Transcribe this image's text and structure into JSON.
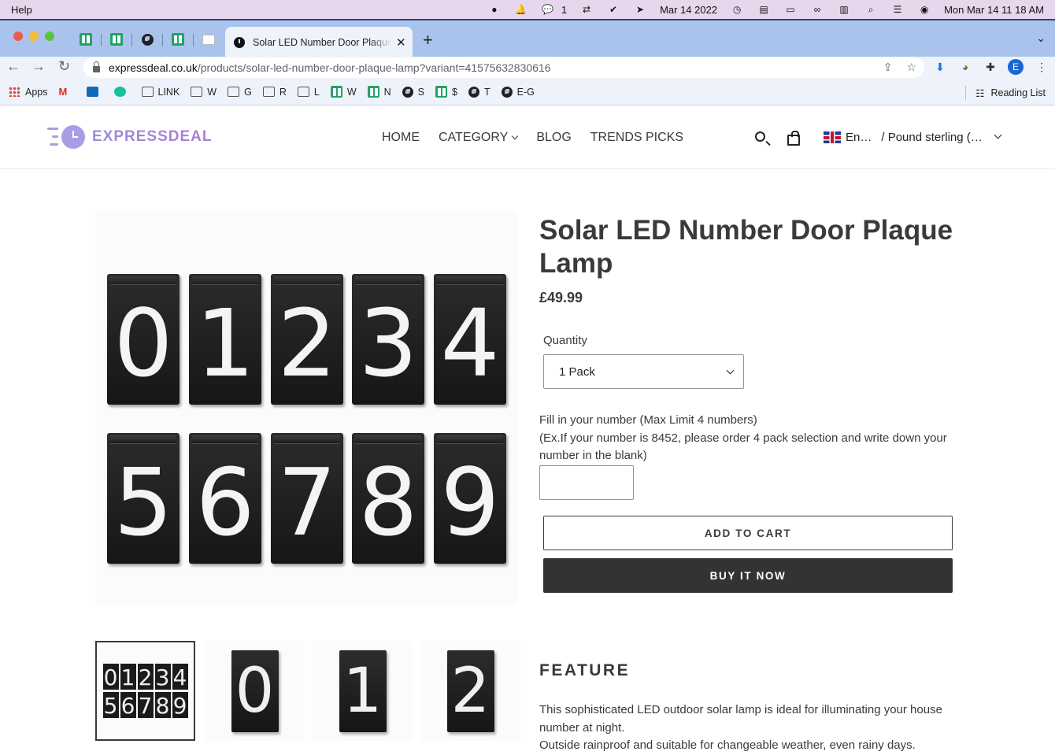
{
  "menubar": {
    "app_menu": "Help",
    "notification_count": "1",
    "date": "Mar 14 2022",
    "clock": "Mon Mar 14  11 18 AM"
  },
  "browser": {
    "active_tab_title": "Solar LED Number Door Plaque Lamp",
    "new_tab": "+",
    "url_host": "expressdeal.co.uk",
    "url_path": "/products/solar-led-number-door-plaque-lamp?variant=41575632830616",
    "profile_initial": "E",
    "bookmarks": [
      "Apps",
      "LINK",
      "W",
      "G",
      "R",
      "L",
      "W",
      "N",
      "S",
      "$",
      "T",
      "E-G"
    ],
    "reading_list": "Reading List"
  },
  "site": {
    "brand": "EXPRESSDEAL",
    "nav": [
      "HOME",
      "CATEGORY",
      "BLOG",
      "TRENDS PICKS"
    ],
    "language": "En…",
    "currency": "/ Pound sterling (…"
  },
  "product": {
    "title": "Solar LED Number Door Plaque Lamp",
    "price": "£49.99",
    "quantity_label": "Quantity",
    "quantity_value": "1 Pack",
    "note_line1": "Fill in your number (Max Limit 4 numbers)",
    "note_line2": "(Ex.If your number is 8452, please order 4 pack selection and write down your number in the blank)",
    "number_value": "",
    "add_to_cart": "ADD TO CART",
    "buy_now": "BUY IT NOW",
    "image_digits": [
      "0",
      "1",
      "2",
      "3",
      "4",
      "5",
      "6",
      "7",
      "8",
      "9"
    ],
    "thumb_digits": [
      "0",
      "1",
      "2"
    ],
    "feature_title": "FEATURE",
    "feature_line1": "This sophisticated LED outdoor solar lamp is ideal for illuminating your house number at night.",
    "feature_line2": "Outside rainproof and suitable for changeable weather, even rainy days."
  }
}
